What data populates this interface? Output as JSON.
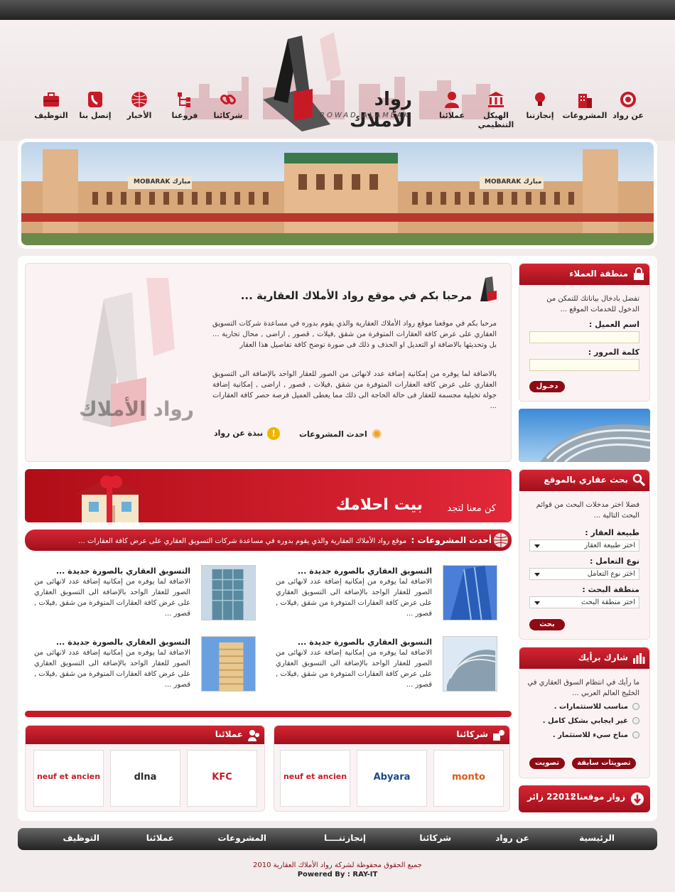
{
  "site": {
    "logo_text": "رواد الأملاك",
    "logo_sub": "ROWAD ALAMLAK"
  },
  "nav": [
    {
      "label": "عن رواد",
      "icon": "target-icon"
    },
    {
      "label": "المشروعات",
      "icon": "building-icon"
    },
    {
      "label": "إنجازتنا",
      "icon": "lightbulb-icon"
    },
    {
      "label": "الهيكل التنظيمي",
      "icon": "bank-icon"
    },
    {
      "label": "عملائنا",
      "icon": "user-icon"
    },
    {
      "label": "شركائنا",
      "icon": "link-icon"
    },
    {
      "label": "فروعنا",
      "icon": "branches-icon"
    },
    {
      "label": "الأخبار",
      "icon": "globe-icon"
    },
    {
      "label": "إتصل بنا",
      "icon": "phone-icon"
    },
    {
      "label": "التوظيف",
      "icon": "briefcase-icon"
    }
  ],
  "banner": {
    "sign1": "MOBARAK مبارك",
    "sign2": "MOBARAK مبارك"
  },
  "welcome": {
    "title": "مرحبا بكم في موقع رواد الأملاك العقارية ...",
    "p1": "مرحبا بكم في موقعنا موقع رواد الأملاك العقارية والذي يقوم بدوره في مساعدة شركات التسويق العقاري على عرض كافة العقارات المتوفرة من شقق ,فيلات , قصور , اراضى , محال تجارية ... بل وتحديثها بالاضافة او التعديل او الحذف و ذلك فى صورة توضح كافة تفاصيل هذا العقار",
    "p2": "بالاضافة لما يوفره من إمكانية إضافة عدد لانهائى من الصور للعقار الواحد بالإضافة الى التسويق العقاري على عرض كافة العقارات المتوفرة من شقق ,فيلات , قصور , اراضى , إمكانية إضافة جولة تخيلية مجسمة للعقار فى حالة الحاجة الى ذلك مما يعطى العميل فرصة حصر كافة العقارات ...",
    "link_about": "نبذة عن رواد",
    "link_projects": "احدث المشروعات",
    "watermark": "رواد الأملاك"
  },
  "promo": {
    "small": "كن معنا لتجد",
    "big": "بيت احلامك"
  },
  "ticker": {
    "label": "أحدث المشروعات :",
    "text": "موقع رواد الأملاك العقارية والذي يقوم بدوره في مساعدة شركات التسويق العقاري على عرض كافة العقارات ..."
  },
  "projects": [
    {
      "title": "التسويق العقاري بالصورة جديدة ...",
      "body": "الاضافة لما يوفره من إمكانية إضافة عدد لانهائى من الصور للعقار الواحد بالإضافة الى التسويق العقاري على عرض كافة العقارات المتوفرة من شقق ,فيلات , قصور ..."
    },
    {
      "title": "التسويق العقاري بالصورة جديدة ...",
      "body": "الاضافة لما يوفره من إمكانية إضافة عدد لانهائى من الصور للعقار الواحد بالإضافة الى التسويق العقاري على عرض كافة العقارات المتوفرة من شقق ,فيلات , قصور ..."
    },
    {
      "title": "التسويق العقاري بالصورة جديدة ...",
      "body": "الاضافة لما يوفره من إمكانية إضافة عدد لانهائى من الصور للعقار الواحد بالإضافة الى التسويق العقاري على عرض كافة العقارات المتوفرة من شقق ,فيلات , قصور ..."
    },
    {
      "title": "التسويق العقاري بالصورة جديدة ...",
      "body": "الاضافة لما يوفره من إمكانية إضافة عدد لانهائى من الصور للعقار الواحد بالإضافة الى التسويق العقاري على عرض كافة العقارات المتوفرة من شقق ,فيلات , قصور ..."
    }
  ],
  "partners": {
    "title": "شركائنا",
    "logos": [
      "monto",
      "Abyara",
      "neuf et ancien"
    ]
  },
  "clients": {
    "title": "عملائنا",
    "logos": [
      "KFC",
      "dlna",
      "neuf et ancien"
    ]
  },
  "login": {
    "title": "منطقة العملاء",
    "intro": "تفضل بادخال بياناتك للتمكن من الدخول للخدمات الموقع ...",
    "user_label": "اسم العميل :",
    "pass_label": "كلمة المرور :",
    "button": "دخـول"
  },
  "search": {
    "title": "بحث عقاري بالموقع",
    "intro": "فضلا اختر مدخلات البحث من قوائم البحث التالية ...",
    "type_label": "طبيعة العقار :",
    "type_value": "اختر طبيعة العقار",
    "deal_label": "نوع التعامل :",
    "deal_value": "اختر نوع التعامل",
    "area_label": "منطقة البحث :",
    "area_value": "اختر منطقة البحث",
    "button": "بحث"
  },
  "poll": {
    "title": "شارك برأيك",
    "question": "ما رأيك في انتظام السوق العقاري في الخليج العالم العربي ...",
    "options": [
      "مناسب للاستثمارات .",
      "غير ايجابي بشكل كامل .",
      "مناخ سيء للاستثمار ."
    ],
    "vote": "تصويت",
    "previous": "تصويتات سابقة"
  },
  "visitors": {
    "label": "زوار موقعنا :",
    "count": "22012 زائر"
  },
  "footer": {
    "links": [
      "الرئيسية",
      "عن رواد",
      "شركائنا",
      "إنجازتنــــا",
      "المشروعات",
      "عملائنا",
      "التوظيف"
    ],
    "copyright": "جميع الحقوق محفوظة لشركة رواد الأملاك العقارية 2010",
    "powered": "Powered By : RAY-IT"
  },
  "colors": {
    "primary": "#c81a26",
    "dark": "#222222",
    "bg": "#f2ecec"
  }
}
